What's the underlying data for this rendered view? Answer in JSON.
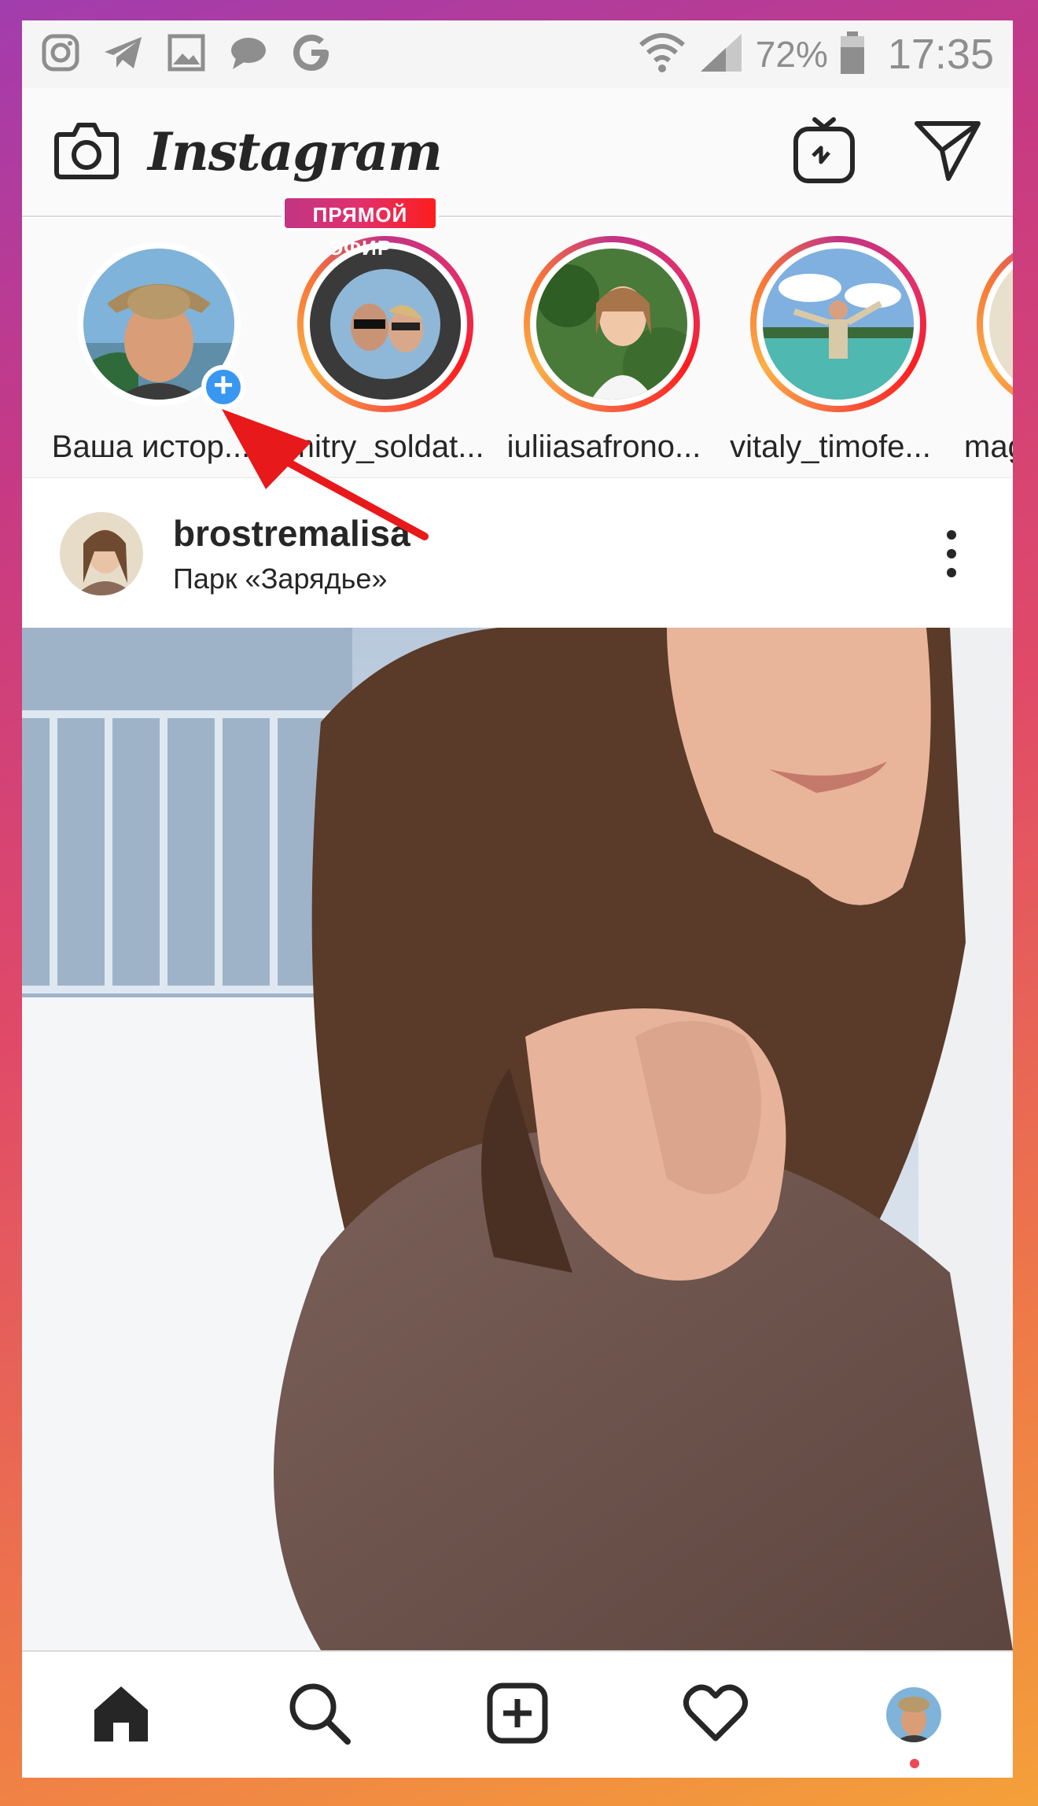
{
  "status_bar": {
    "icons": [
      "instagram-icon",
      "telegram-icon",
      "gallery-icon",
      "message-icon",
      "google-icon"
    ],
    "battery": "72%",
    "time": "17:35"
  },
  "header": {
    "logo": "Instagram",
    "left_icon": "camera-icon",
    "right_icons": [
      "igtv-icon",
      "direct-icon"
    ]
  },
  "stories": [
    {
      "label": "Ваша истор...",
      "badge": "+",
      "own": true
    },
    {
      "label": "dmitry_soldat...",
      "badge": "ПРЯМОЙ ЭФИР",
      "live": true
    },
    {
      "label": "iuliiasafrono...",
      "badge": ""
    },
    {
      "label": "vitaly_timofe...",
      "badge": ""
    },
    {
      "label": "mag",
      "badge": ""
    }
  ],
  "post": {
    "username": "brostremalisa",
    "location": "Парк «Зарядье»"
  },
  "bottom_nav": [
    "home-icon",
    "search-icon",
    "new-post-icon",
    "activity-icon",
    "profile-avatar"
  ],
  "colors": {
    "frame_gradient": [
      "#a23dae",
      "#e04a68",
      "#f4a03a"
    ],
    "accent_blue": "#3897f0",
    "annotation_arrow": "#e8191b"
  }
}
